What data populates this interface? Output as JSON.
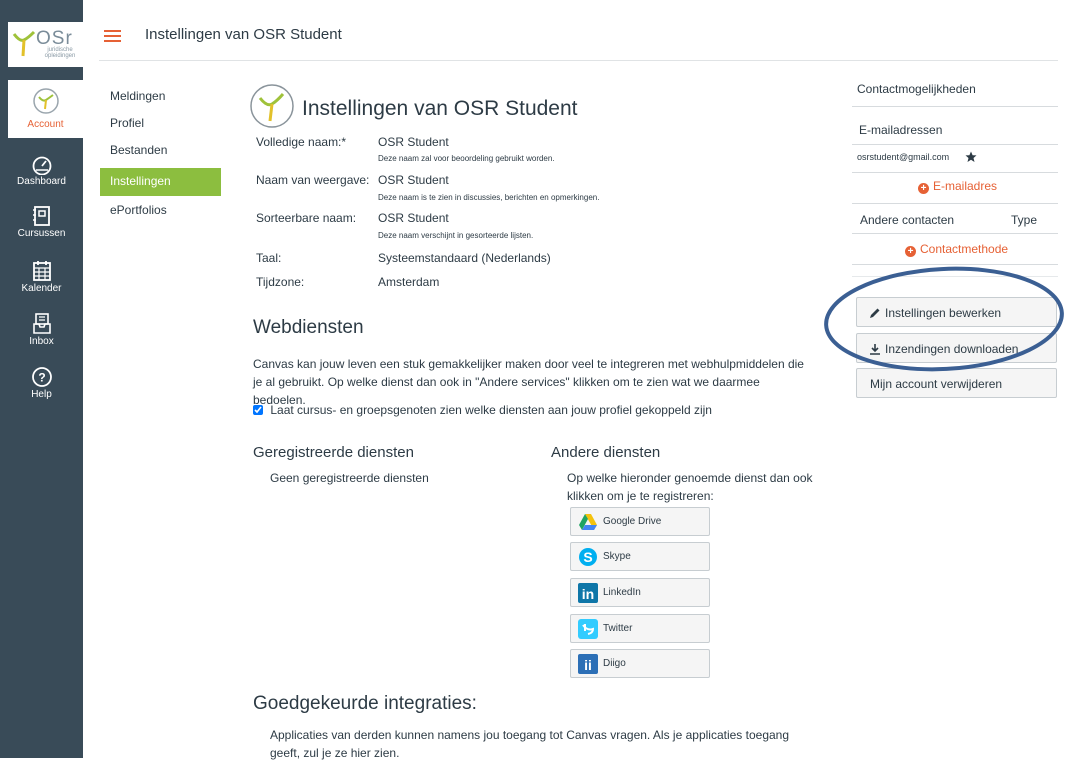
{
  "nav": {
    "logo_text": "OSr",
    "logo_sub": "juridische opleidingen",
    "items": [
      {
        "label": "Account",
        "icon": "account-avatar-icon"
      },
      {
        "label": "Dashboard",
        "icon": "dashboard-gauge-icon"
      },
      {
        "label": "Cursussen",
        "icon": "courses-book-icon"
      },
      {
        "label": "Kalender",
        "icon": "calendar-icon"
      },
      {
        "label": "Inbox",
        "icon": "inbox-icon"
      },
      {
        "label": "Help",
        "icon": "help-icon"
      }
    ]
  },
  "header": {
    "title": "Instellingen van OSR Student"
  },
  "left_nav": {
    "items": [
      {
        "label": "Meldingen"
      },
      {
        "label": "Profiel"
      },
      {
        "label": "Bestanden"
      },
      {
        "label": "Instellingen",
        "active": true
      },
      {
        "label": "ePortfolios"
      }
    ]
  },
  "profile": {
    "title": "Instellingen van OSR Student",
    "fields": [
      {
        "label": "Volledige naam:*",
        "value": "OSR Student",
        "help": "Deze naam zal voor beoordeling gebruikt worden."
      },
      {
        "label": "Naam van weergave:",
        "value": "OSR Student",
        "help": "Deze naam is te zien in discussies, berichten en opmerkingen."
      },
      {
        "label": "Sorteerbare naam:",
        "value": "OSR Student",
        "help": "Deze naam verschijnt in gesorteerde lijsten."
      },
      {
        "label": "Taal:",
        "value": "Systeemstandaard (Nederlands)"
      },
      {
        "label": "Tijdzone:",
        "value": "Amsterdam"
      }
    ]
  },
  "web_services": {
    "heading": "Webdiensten",
    "description": "Canvas kan jouw leven een stuk gemakkelijker maken door veel te integreren met webhulpmiddelen die je al gebruikt. Op welke dienst dan ook in \"Andere services\" klikken om te zien wat we daarmee bedoelen.",
    "checkbox_label": "Laat cursus- en groepsgenoten zien welke diensten aan jouw profiel gekoppeld zijn",
    "checkbox_checked": true,
    "registered_heading": "Geregistreerde diensten",
    "registered_empty": "Geen geregistreerde diensten",
    "other_heading": "Andere diensten",
    "other_intro": "Op welke hieronder genoemde dienst dan ook klikken om je te registreren:",
    "services": [
      {
        "label": "Google Drive",
        "icon": "google-drive-icon"
      },
      {
        "label": "Skype",
        "icon": "skype-icon"
      },
      {
        "label": "LinkedIn",
        "icon": "linkedin-icon"
      },
      {
        "label": "Twitter",
        "icon": "twitter-icon"
      },
      {
        "label": "Diigo",
        "icon": "diigo-icon"
      }
    ]
  },
  "integrations": {
    "heading": "Goedgekeurde integraties:",
    "description": "Applicaties van derden kunnen namens jou toegang tot Canvas vragen. Als je applicaties toegang geeft, zul je ze hier zien."
  },
  "contact": {
    "heading": "Contactmogelijkheden",
    "email_heading": "E-mailadressen",
    "email": "osrstudent@gmail.com",
    "add_email": "E-mailadres",
    "other_contacts": "Andere contacten",
    "type_label": "Type",
    "add_contact": "Contactmethode",
    "edit_settings": "Instellingen bewerken",
    "download_submissions": "Inzendingen downloaden",
    "delete_account": "Mijn account verwijderen"
  },
  "colors": {
    "nav_bg": "#394b58",
    "accent": "#e66135",
    "active_green": "#8cbe3f",
    "annotation": "#3b5f93"
  }
}
